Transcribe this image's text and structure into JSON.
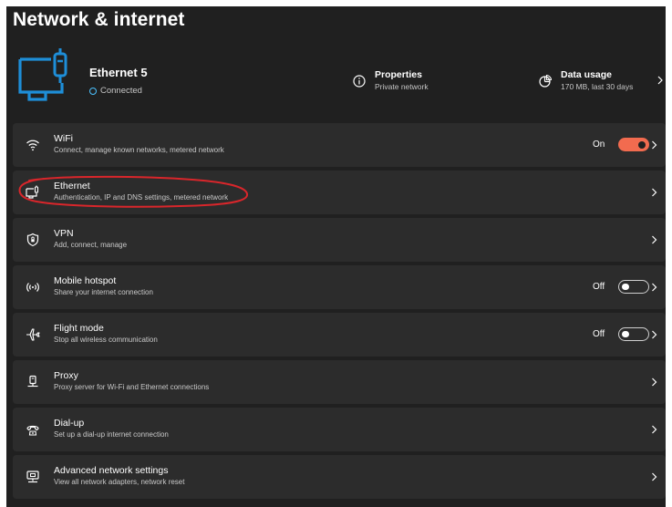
{
  "page": {
    "title": "Network & internet"
  },
  "status": {
    "device_name": "Ethernet 5",
    "device_state": "Connected",
    "properties_title": "Properties",
    "properties_sub": "Private network",
    "data_usage_title": "Data usage",
    "data_usage_sub": "170 MB, last 30 days"
  },
  "rows": [
    {
      "icon": "wifi-icon",
      "title": "WiFi",
      "subtitle": "Connect, manage known networks, metered network",
      "toggle_label": "On",
      "toggle_state": "on"
    },
    {
      "icon": "ethernet-icon",
      "title": "Ethernet",
      "subtitle": "Authentication, IP and DNS settings, metered network"
    },
    {
      "icon": "vpn-shield-icon",
      "title": "VPN",
      "subtitle": "Add, connect, manage"
    },
    {
      "icon": "mobile-hotspot-icon",
      "title": "Mobile hotspot",
      "subtitle": "Share your internet connection",
      "toggle_label": "Off",
      "toggle_state": "off"
    },
    {
      "icon": "airplane-icon",
      "title": "Flight mode",
      "subtitle": "Stop all wireless communication",
      "toggle_label": "Off",
      "toggle_state": "off"
    },
    {
      "icon": "proxy-icon",
      "title": "Proxy",
      "subtitle": "Proxy server for Wi-Fi and Ethernet connections"
    },
    {
      "icon": "dial-up-icon",
      "title": "Dial-up",
      "subtitle": "Set up a dial-up internet connection"
    },
    {
      "icon": "advanced-network-icon",
      "title": "Advanced network settings",
      "subtitle": "View all network adapters, network reset"
    }
  ],
  "colors": {
    "background": "#202020",
    "card": "#2c2c2c",
    "accent": "#f26b4f",
    "device_icon": "#1e8ed8",
    "annotation": "#d9262b"
  }
}
